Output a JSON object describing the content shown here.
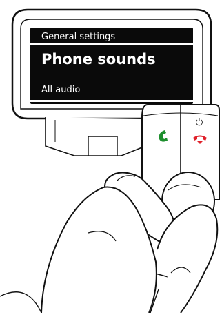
{
  "display": {
    "header": "General settings",
    "title": "Phone sounds",
    "footer": "All audio"
  },
  "controls": {
    "answer_key": {
      "icon": "phone-answer-icon",
      "color": "#1e8f2e"
    },
    "end_key": {
      "icon": "phone-hangup-icon",
      "color": "#e0202a"
    },
    "power_symbol": {
      "icon": "power-icon",
      "color": "#333333"
    },
    "side_key": {
      "icon": "phone-handset-icon",
      "color": "#222222"
    }
  }
}
